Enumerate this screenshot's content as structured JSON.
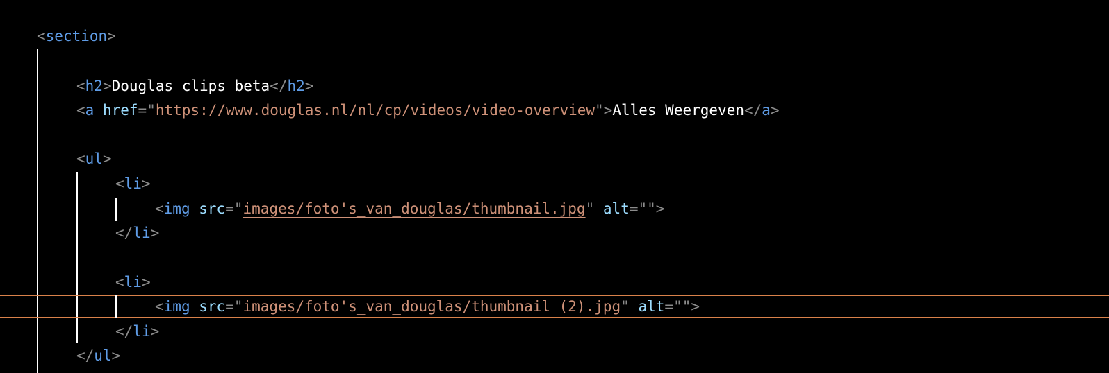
{
  "editor": {
    "colors": {
      "background": "#000000",
      "tag": "#5f9ce6",
      "attribute": "#9cdcfe",
      "string": "#ce9178",
      "text": "#ffffff",
      "punctuation": "#8c8c8c",
      "current_line_border": "#d9814a",
      "indent_guide": "#ffffff"
    },
    "lines": {
      "section_open": {
        "tag": "section"
      },
      "h2": {
        "tag": "h2",
        "text": "Douglas clips beta"
      },
      "link": {
        "tag": "a",
        "attr": "href",
        "href": "https://www.douglas.nl/nl/cp/videos/video-overview",
        "text": "Alles Weergeven"
      },
      "ul_open": {
        "tag": "ul"
      },
      "li1_open": {
        "tag": "li"
      },
      "img1": {
        "tag": "img",
        "src_attr": "src",
        "src": "images/foto's_van_douglas/thumbnail.jpg",
        "alt_attr": "alt"
      },
      "li1_close": {
        "tag": "li"
      },
      "li2_open": {
        "tag": "li"
      },
      "img2": {
        "tag": "img",
        "src_attr": "src",
        "src": "images/foto's_van_douglas/thumbnail (2).jpg",
        "alt_attr": "alt"
      },
      "li2_close": {
        "tag": "li"
      },
      "ul_close": {
        "tag": "ul"
      }
    }
  }
}
